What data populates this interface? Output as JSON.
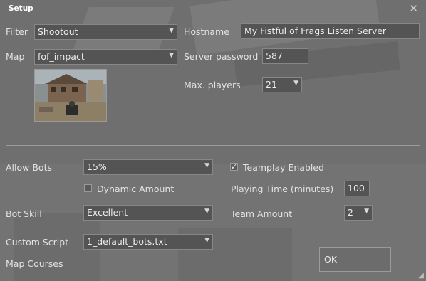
{
  "window": {
    "title": "Setup",
    "close_glyph": "✕"
  },
  "filter": {
    "label": "Filter",
    "value": "Shootout"
  },
  "map": {
    "label": "Map",
    "value": "fof_impact"
  },
  "hostname": {
    "label": "Hostname",
    "value": "My Fistful of Frags Listen Server"
  },
  "server_password": {
    "label": "Server password",
    "value": "587"
  },
  "max_players": {
    "label": "Max. players",
    "value": "21"
  },
  "allow_bots": {
    "label": "Allow Bots",
    "value": "15%"
  },
  "dynamic_amount": {
    "label": "Dynamic Amount",
    "checked": false
  },
  "teamplay": {
    "label": "Teamplay Enabled",
    "checked": true,
    "check_glyph": "✓"
  },
  "playing_time": {
    "label": "Playing Time (minutes)",
    "value": "100"
  },
  "bot_skill": {
    "label": "Bot Skill",
    "value": "Excellent"
  },
  "team_amount": {
    "label": "Team Amount",
    "value": "2"
  },
  "custom_script": {
    "label": "Custom Script",
    "value": "1_default_bots.txt"
  },
  "map_courses": {
    "label": "Map Courses"
  },
  "ok_button": {
    "label": "OK"
  },
  "icons": {
    "dropdown": "dropdown-arrow-icon",
    "close": "close-icon",
    "resize": "resize-grip-icon"
  },
  "colors": {
    "panel_bg": "#6f6f6f",
    "field_bg": "#545454",
    "field_border": "#878787",
    "text": "#e6e6e6"
  }
}
